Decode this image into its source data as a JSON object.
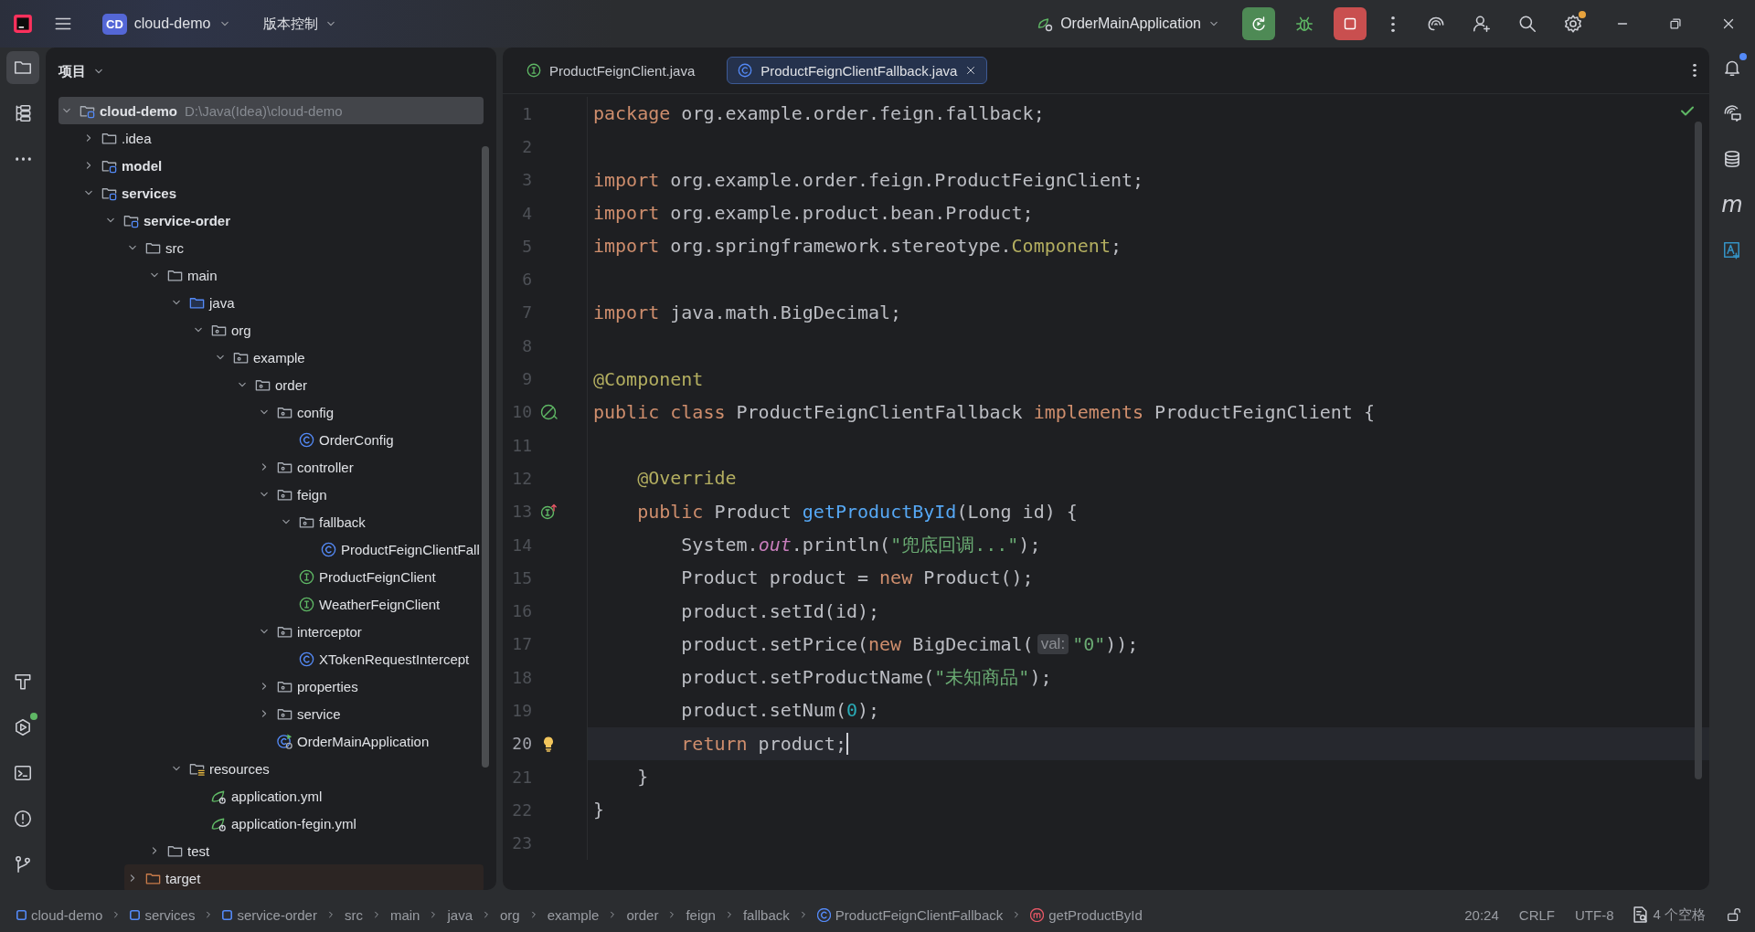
{
  "title_bar": {
    "project": {
      "badge": "CD",
      "name": "cloud-demo"
    },
    "vcs_menu": "版本控制",
    "run_config": "OrderMainApplication",
    "actions": [
      {
        "kind": "rerun",
        "badge": false
      },
      {
        "kind": "debug",
        "badge": false
      },
      {
        "kind": "stop",
        "badge": false
      },
      {
        "kind": "more",
        "badge": false
      },
      {
        "kind": "ai",
        "badge": false
      },
      {
        "kind": "add-user",
        "badge": false
      },
      {
        "kind": "search",
        "badge": false
      },
      {
        "kind": "settings",
        "badge": true
      }
    ],
    "window_controls": [
      {
        "kind": "minimize"
      },
      {
        "kind": "restore"
      },
      {
        "kind": "close"
      }
    ]
  },
  "left_toolbar": {
    "top": [
      {
        "kind": "project",
        "selected": true,
        "badge": false
      },
      {
        "kind": "structure",
        "selected": false,
        "badge": false
      },
      {
        "kind": "more",
        "selected": false,
        "badge": false
      }
    ],
    "bottom": [
      {
        "kind": "build",
        "selected": false,
        "badge": false
      },
      {
        "kind": "services",
        "selected": false,
        "badge": true
      },
      {
        "kind": "terminal",
        "selected": false,
        "badge": false
      },
      {
        "kind": "problems",
        "selected": false,
        "badge": false
      },
      {
        "kind": "git",
        "selected": false,
        "badge": false
      }
    ]
  },
  "project_panel": {
    "title": "项目",
    "tree": [
      {
        "label": "cloud-demo",
        "kind": "module",
        "hint": "D:\\Java(Idea)\\cloud-demo",
        "expanded": true,
        "selected": true,
        "children": [
          {
            "label": ".idea",
            "kind": "folder",
            "expanded": false,
            "selected": false
          },
          {
            "label": "model",
            "kind": "module",
            "expanded": false,
            "selected": false
          },
          {
            "label": "services",
            "kind": "module",
            "expanded": true,
            "selected": false,
            "children": [
              {
                "label": "service-order",
                "kind": "module",
                "expanded": true,
                "selected": false,
                "children": [
                  {
                    "label": "src",
                    "kind": "folder",
                    "expanded": true,
                    "selected": false,
                    "children": [
                      {
                        "label": "main",
                        "kind": "folder",
                        "expanded": true,
                        "selected": false,
                        "children": [
                          {
                            "label": "java",
                            "kind": "source",
                            "expanded": true,
                            "selected": false,
                            "children": [
                              {
                                "label": "org",
                                "kind": "package",
                                "expanded": true,
                                "selected": false,
                                "children": [
                                  {
                                    "label": "example",
                                    "kind": "package",
                                    "expanded": true,
                                    "selected": false,
                                    "children": [
                                      {
                                        "label": "order",
                                        "kind": "package",
                                        "expanded": true,
                                        "selected": false,
                                        "children": [
                                          {
                                            "label": "config",
                                            "kind": "package",
                                            "expanded": true,
                                            "selected": false,
                                            "children": [
                                              {
                                                "label": "OrderConfig",
                                                "kind": "class",
                                                "selected": false
                                              }
                                            ]
                                          },
                                          {
                                            "label": "controller",
                                            "kind": "package",
                                            "expanded": false,
                                            "selected": false
                                          },
                                          {
                                            "label": "feign",
                                            "kind": "package",
                                            "expanded": true,
                                            "selected": false,
                                            "children": [
                                              {
                                                "label": "fallback",
                                                "kind": "package",
                                                "expanded": true,
                                                "selected": false,
                                                "children": [
                                                  {
                                                    "label": "ProductFeignClientFall",
                                                    "kind": "class",
                                                    "selected": false
                                                  }
                                                ]
                                              },
                                              {
                                                "label": "ProductFeignClient",
                                                "kind": "interface",
                                                "selected": false
                                              },
                                              {
                                                "label": "WeatherFeignClient",
                                                "kind": "interface",
                                                "selected": false
                                              }
                                            ]
                                          },
                                          {
                                            "label": "interceptor",
                                            "kind": "package",
                                            "expanded": true,
                                            "selected": false,
                                            "children": [
                                              {
                                                "label": "XTokenRequestIntercept",
                                                "kind": "class",
                                                "selected": false
                                              }
                                            ]
                                          },
                                          {
                                            "label": "properties",
                                            "kind": "package",
                                            "expanded": false,
                                            "selected": false
                                          },
                                          {
                                            "label": "service",
                                            "kind": "package",
                                            "expanded": false,
                                            "selected": false
                                          },
                                          {
                                            "label": "OrderMainApplication",
                                            "kind": "main-class",
                                            "selected": false
                                          }
                                        ]
                                      }
                                    ]
                                  }
                                ]
                              }
                            ]
                          },
                          {
                            "label": "resources",
                            "kind": "resources",
                            "expanded": true,
                            "selected": false,
                            "children": [
                              {
                                "label": "application.yml",
                                "kind": "yml",
                                "selected": false
                              },
                              {
                                "label": "application-fegin.yml",
                                "kind": "yml",
                                "selected": false
                              }
                            ]
                          }
                        ]
                      },
                      {
                        "label": "test",
                        "kind": "folder",
                        "expanded": false,
                        "selected": false
                      }
                    ]
                  },
                  {
                    "label": "target",
                    "kind": "excluded",
                    "expanded": false,
                    "selected": false
                  }
                ]
              }
            ]
          }
        ]
      }
    ]
  },
  "editor": {
    "tabs": [
      {
        "label": "ProductFeignClient.java",
        "kind": "interface",
        "selected": false
      },
      {
        "label": "ProductFeignClientFallback.java",
        "kind": "class",
        "selected": true
      }
    ],
    "inspections_ok": true,
    "lines": [
      {
        "number": "1",
        "current": false,
        "tokens": [
          {
            "kind": "kw",
            "text": "package"
          },
          {
            "kind": "plain",
            "text": " org.example.order.feign.fallback;"
          }
        ]
      },
      {
        "number": "2",
        "current": false
      },
      {
        "number": "3",
        "current": false,
        "tokens": [
          {
            "kind": "kw",
            "text": "import"
          },
          {
            "kind": "plain",
            "text": " org.example.order.feign.ProductFeignClient;"
          }
        ]
      },
      {
        "number": "4",
        "current": false,
        "tokens": [
          {
            "kind": "kw",
            "text": "import"
          },
          {
            "kind": "plain",
            "text": " org.example.product.bean.Product;"
          }
        ]
      },
      {
        "number": "5",
        "current": false,
        "tokens": [
          {
            "kind": "kw",
            "text": "import"
          },
          {
            "kind": "plain",
            "text": " org.springframework.stereotype."
          },
          {
            "kind": "ann",
            "text": "Component"
          },
          {
            "kind": "plain",
            "text": ";"
          }
        ]
      },
      {
        "number": "6",
        "current": false
      },
      {
        "number": "7",
        "current": false,
        "tokens": [
          {
            "kind": "kw",
            "text": "import"
          },
          {
            "kind": "plain",
            "text": " java.math.BigDecimal;"
          }
        ]
      },
      {
        "number": "8",
        "current": false
      },
      {
        "number": "9",
        "current": false,
        "tokens": [
          {
            "kind": "ann",
            "text": "@Component"
          }
        ]
      },
      {
        "number": "10",
        "current": false,
        "gutter": {
          "kind": "implemented"
        },
        "tokens": [
          {
            "kind": "kw",
            "text": "public class"
          },
          {
            "kind": "plain",
            "text": " ProductFeignClientFallback "
          },
          {
            "kind": "kw",
            "text": "implements"
          },
          {
            "kind": "plain",
            "text": " ProductFeignClient {"
          }
        ]
      },
      {
        "number": "11",
        "current": false
      },
      {
        "number": "12",
        "current": false,
        "tokens": [
          {
            "kind": "ann",
            "text": "    @Override"
          }
        ]
      },
      {
        "number": "13",
        "current": false,
        "gutter": {
          "kind": "implements"
        },
        "tokens": [
          {
            "kind": "kw",
            "text": "    public"
          },
          {
            "kind": "plain",
            "text": " Product "
          },
          {
            "kind": "fn",
            "text": "getProductById"
          },
          {
            "kind": "plain",
            "text": "(Long id) {"
          }
        ]
      },
      {
        "number": "14",
        "current": false,
        "tokens": [
          {
            "kind": "plain",
            "text": "        System."
          },
          {
            "kind": "static",
            "text": "out"
          },
          {
            "kind": "plain",
            "text": ".println("
          },
          {
            "kind": "str",
            "text": "\"兜底回调...\""
          },
          {
            "kind": "plain",
            "text": ");"
          }
        ]
      },
      {
        "number": "15",
        "current": false,
        "tokens": [
          {
            "kind": "plain",
            "text": "        Product product = "
          },
          {
            "kind": "kw",
            "text": "new"
          },
          {
            "kind": "plain",
            "text": " Product();"
          }
        ]
      },
      {
        "number": "16",
        "current": false,
        "tokens": [
          {
            "kind": "plain",
            "text": "        product.setId(id);"
          }
        ]
      },
      {
        "number": "17",
        "current": false,
        "tokens": [
          {
            "kind": "plain",
            "text": "        product.setPrice("
          },
          {
            "kind": "kw",
            "text": "new"
          },
          {
            "kind": "plain",
            "text": " BigDecimal("
          },
          {
            "kind": "hint",
            "text": "val:"
          },
          {
            "kind": "str",
            "text": "\"0\""
          },
          {
            "kind": "plain",
            "text": "));"
          }
        ]
      },
      {
        "number": "18",
        "current": false,
        "tokens": [
          {
            "kind": "plain",
            "text": "        product.setProductName("
          },
          {
            "kind": "str",
            "text": "\"未知商品\""
          },
          {
            "kind": "plain",
            "text": ");"
          }
        ]
      },
      {
        "number": "19",
        "current": false,
        "tokens": [
          {
            "kind": "plain",
            "text": "        product.setNum("
          },
          {
            "kind": "num",
            "text": "0"
          },
          {
            "kind": "plain",
            "text": ");"
          }
        ]
      },
      {
        "number": "20",
        "current": true,
        "gutter": {
          "kind": "bulb"
        },
        "tokens": [
          {
            "kind": "kw",
            "text": "        return"
          },
          {
            "kind": "plain",
            "text": " product;"
          }
        ]
      },
      {
        "number": "21",
        "current": false,
        "tokens": [
          {
            "kind": "plain",
            "text": "    }"
          }
        ]
      },
      {
        "number": "22",
        "current": false,
        "tokens": [
          {
            "kind": "plain",
            "text": "}"
          }
        ]
      },
      {
        "number": "23",
        "current": false
      }
    ]
  },
  "right_toolbar": [
    {
      "kind": "notifications",
      "badge": true
    },
    {
      "kind": "ai-chat",
      "badge": false
    },
    {
      "kind": "database",
      "badge": false
    },
    {
      "kind": "maven",
      "glyph": "m",
      "badge": false
    },
    {
      "kind": "translate",
      "badge": false
    }
  ],
  "status_bar": {
    "breadcrumbs": [
      {
        "text": "cloud-demo",
        "kind": "module"
      },
      {
        "text": "services",
        "kind": "module"
      },
      {
        "text": "service-order",
        "kind": "module"
      },
      {
        "text": "src",
        "kind": "folder"
      },
      {
        "text": "main",
        "kind": "folder"
      },
      {
        "text": "java",
        "kind": "folder"
      },
      {
        "text": "org",
        "kind": "folder"
      },
      {
        "text": "example",
        "kind": "folder"
      },
      {
        "text": "order",
        "kind": "folder"
      },
      {
        "text": "feign",
        "kind": "folder"
      },
      {
        "text": "fallback",
        "kind": "folder"
      },
      {
        "text": "ProductFeignClientFallback",
        "kind": "class"
      },
      {
        "text": "getProductById",
        "kind": "method"
      }
    ],
    "position": "20:24",
    "line_separator": "CRLF",
    "encoding": "UTF-8",
    "indent": "4 个空格",
    "locked": false
  }
}
